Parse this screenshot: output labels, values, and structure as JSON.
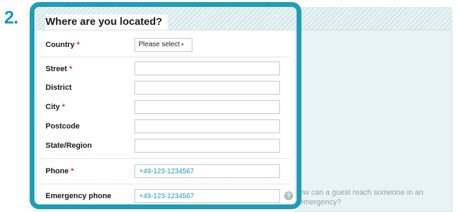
{
  "step": {
    "number": "2."
  },
  "section": {
    "title": "Where are you located?"
  },
  "country": {
    "label": "Country",
    "required_mark": "*",
    "select_value": "Please select",
    "select_arrow": "▾"
  },
  "street": {
    "label": "Street",
    "required_mark": "*",
    "value": ""
  },
  "district": {
    "label": "District",
    "value": ""
  },
  "city": {
    "label": "City",
    "required_mark": "*",
    "value": ""
  },
  "postcode": {
    "label": "Postcode",
    "value": ""
  },
  "state": {
    "label": "State/Region",
    "value": ""
  },
  "phone": {
    "label": "Phone",
    "required_mark": "*",
    "value": "+49-123-1234567"
  },
  "emergency": {
    "label": "Emergency phone",
    "value": "+49-123-1234567",
    "help_icon": "?",
    "help_text": "ow can a guest reach someone in an emergency?"
  },
  "colors": {
    "accent": "#1f9db5",
    "required": "#d0313a",
    "panel": "#e8f3f5",
    "help_text": "#8fa5ab"
  },
  "icons": {
    "help": "question-icon",
    "dropdown": "chevron-down-icon"
  }
}
